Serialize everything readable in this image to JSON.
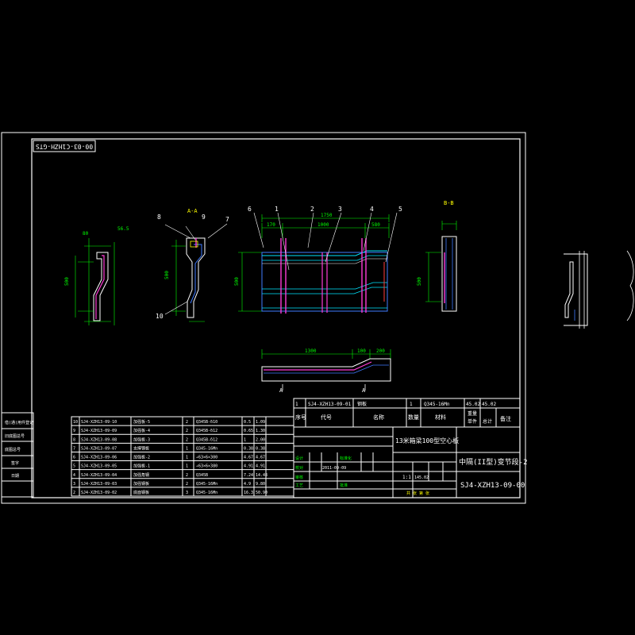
{
  "drawing": {
    "header_code": "00-03-C1HZH-GTS",
    "title": "中隔(II型)变节段-2",
    "code": "SJ4-XZH13-09-00",
    "top_part_code": "SJ4-XZH13-09-01",
    "top_part_name": "钢板",
    "top_part_qty": "1",
    "top_part_material": "Q345-16Mn",
    "top_part_unit_wt": "45.02",
    "top_part_total_wt": "45.02",
    "header_columns": [
      "序号",
      "代号",
      "名称",
      "数量",
      "材料",
      "单件",
      "总计",
      "备注"
    ],
    "weight_col": "重量",
    "desc": "13米箱梁100型空心板",
    "scale": "1:1",
    "sheet_label": "共 张 第 张",
    "roles": [
      "设计",
      "审核",
      "工艺",
      "标准化",
      "批准",
      "校对"
    ],
    "approval_date": "2011-09-09",
    "weight_total": "145.02"
  },
  "parts": [
    {
      "no": "10",
      "code": "SJ4-XZH13-09-10",
      "name": "加强板-5",
      "qty": "2",
      "mat": "Q345B-δ10",
      "w1": "0.5",
      "w2": "1.09"
    },
    {
      "no": "9",
      "code": "SJ4-XZH13-09-09",
      "name": "加强板-4",
      "qty": "2",
      "mat": "Q345B-δ12",
      "w1": "0.65",
      "w2": "1.30"
    },
    {
      "no": "8",
      "code": "SJ4-XZH13-09-08",
      "name": "加强板-3",
      "qty": "2",
      "mat": "Q345B-δ12",
      "w1": "1",
      "w2": "2.00"
    },
    {
      "no": "7",
      "code": "SJ4-XZH13-09-07",
      "name": "支撑钢板",
      "qty": "1",
      "mat": "Q345-16Mn",
      "w1": "0.38",
      "w2": "0.38"
    },
    {
      "no": "6",
      "code": "SJ4-XZH13-09-06",
      "name": "加强板-2",
      "qty": "1",
      "mat": "∠63×6×300",
      "w1": "4.67",
      "w2": "4.67"
    },
    {
      "no": "5",
      "code": "SJ4-XZH13-09-05",
      "name": "加强板-1",
      "qty": "1",
      "mat": "∠63×6×380",
      "w1": "4.91",
      "w2": "4.91"
    },
    {
      "no": "4",
      "code": "SJ4-XZH13-09-04",
      "name": "加强角钢",
      "qty": "2",
      "mat": "Q345B",
      "w1": "7.24",
      "w2": "14.48"
    },
    {
      "no": "3",
      "code": "SJ4-XZH13-09-03",
      "name": "加强钢板",
      "qty": "2",
      "mat": "Q345-16Mn",
      "w1": "4.9",
      "w2": "9.80"
    },
    {
      "no": "2",
      "code": "SJ4-XZH13-09-02",
      "name": "底面钢板",
      "qty": "3",
      "mat": "Q345-16Mn",
      "w1": "16.3",
      "w2": "50.90"
    }
  ],
  "side_labels": [
    "借(通)用件登记",
    "旧底图总号",
    "底图总号",
    "签字",
    "日期"
  ],
  "callouts": [
    "1",
    "2",
    "3",
    "4",
    "5",
    "6",
    "7",
    "8",
    "9",
    "10"
  ],
  "section_labels": {
    "a": "A-A",
    "b": "B-B",
    "c": "A",
    "d": "A"
  },
  "dims": {
    "top_total": "1750",
    "top_left": "170",
    "top_mid": "1000",
    "top_right": "580",
    "plan_long": "1300",
    "plan_a": "100",
    "plan_b": "200",
    "height": "500",
    "small1": "80",
    "small2": "56.5"
  },
  "colors": {
    "frame": "#ffffff",
    "dim": "#00ff00",
    "plate": "#3f7bff",
    "rib": "#ff3bd6",
    "edge": "#00e5ff"
  }
}
